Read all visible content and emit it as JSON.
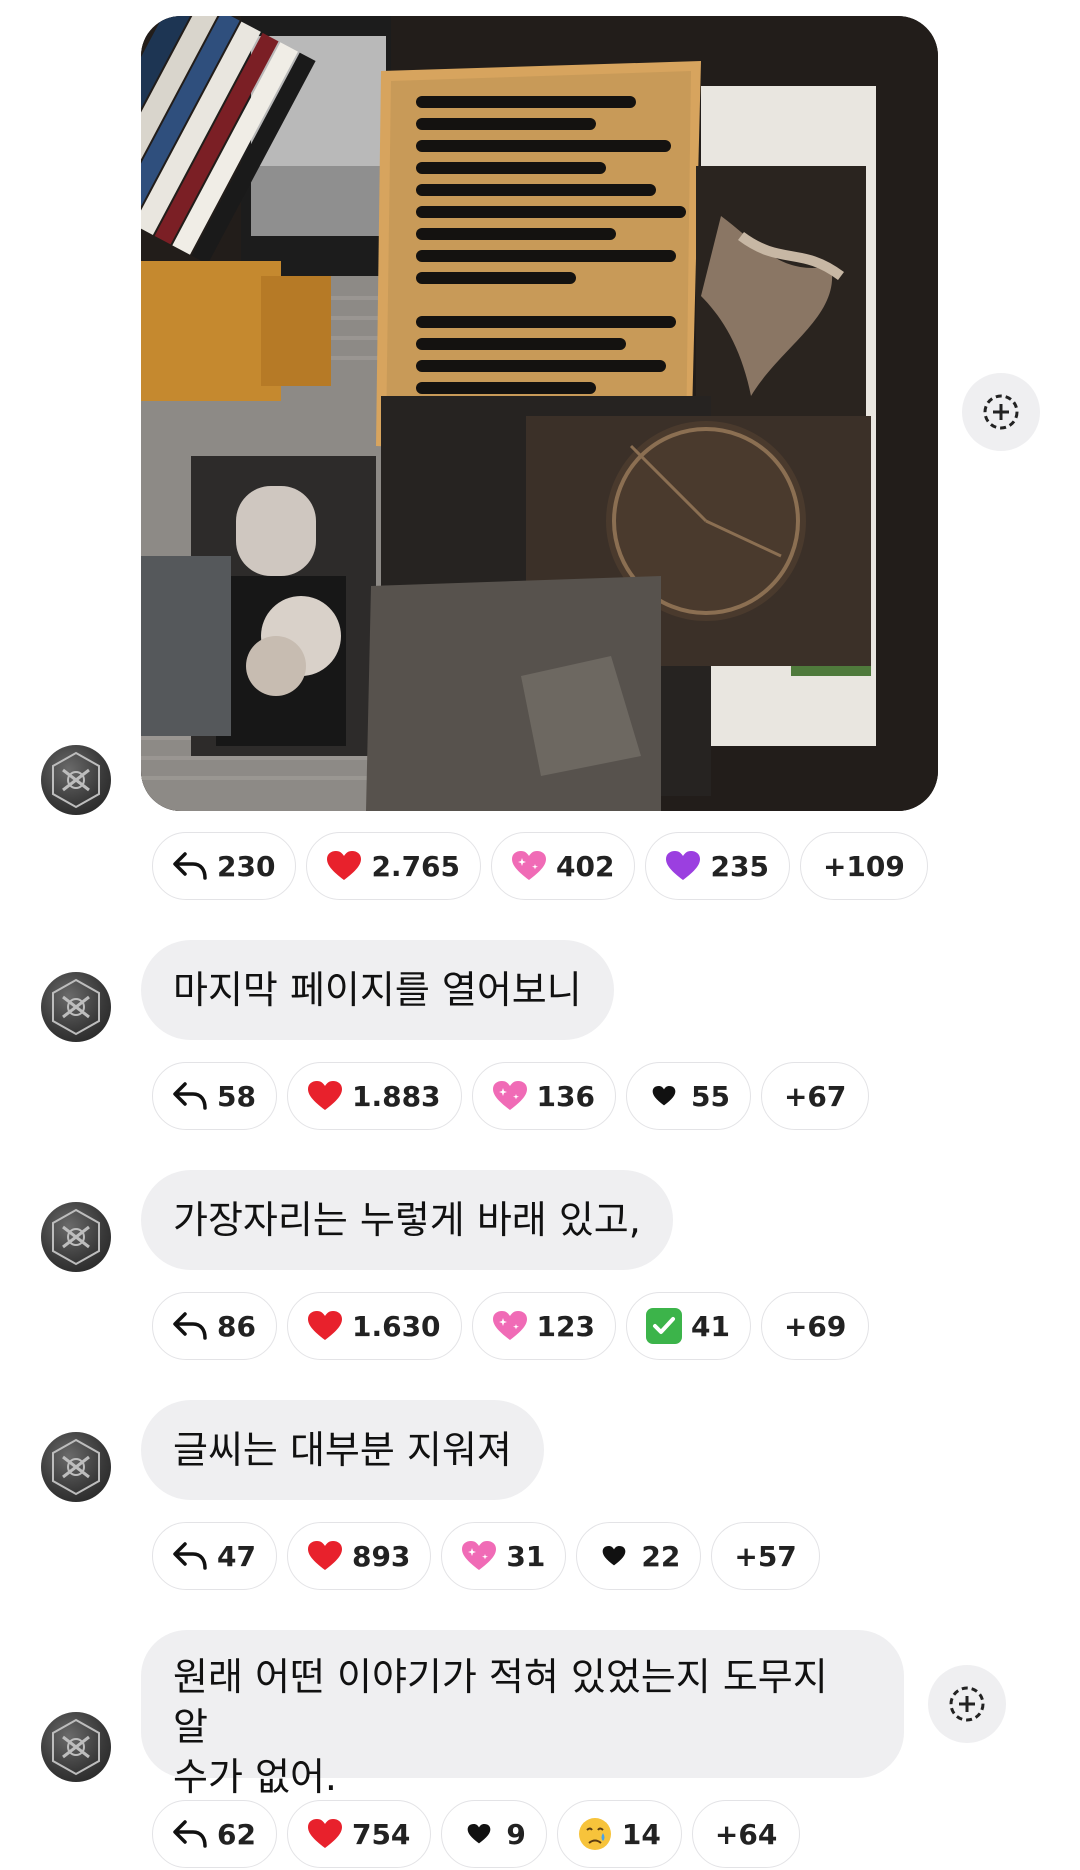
{
  "photo_message": {
    "reactions": [
      {
        "kind": "reply",
        "icon": "reply-icon",
        "count": "230"
      },
      {
        "kind": "emoji",
        "icon": "red-heart-icon",
        "count": "2.765"
      },
      {
        "kind": "emoji",
        "icon": "pink-sparkle-heart-icon",
        "count": "402"
      },
      {
        "kind": "emoji",
        "icon": "purple-heart-icon",
        "count": "235"
      },
      {
        "kind": "more",
        "count": "+109"
      }
    ]
  },
  "messages": [
    {
      "text": "마지막 페이지를 열어보니",
      "reactions": [
        {
          "kind": "reply",
          "icon": "reply-icon",
          "count": "58"
        },
        {
          "kind": "emoji",
          "icon": "red-heart-icon",
          "count": "1.883"
        },
        {
          "kind": "emoji",
          "icon": "pink-sparkle-heart-icon",
          "count": "136"
        },
        {
          "kind": "emoji",
          "icon": "black-heart-icon",
          "count": "55"
        },
        {
          "kind": "more",
          "count": "+67"
        }
      ]
    },
    {
      "text": "가장자리는 누렇게 바래 있고,",
      "reactions": [
        {
          "kind": "reply",
          "icon": "reply-icon",
          "count": "86"
        },
        {
          "kind": "emoji",
          "icon": "red-heart-icon",
          "count": "1.630"
        },
        {
          "kind": "emoji",
          "icon": "pink-sparkle-heart-icon",
          "count": "123"
        },
        {
          "kind": "emoji",
          "icon": "check-mark-icon",
          "count": "41"
        },
        {
          "kind": "more",
          "count": "+69"
        }
      ]
    },
    {
      "text": "글씨는 대부분 지워져",
      "reactions": [
        {
          "kind": "reply",
          "icon": "reply-icon",
          "count": "47"
        },
        {
          "kind": "emoji",
          "icon": "red-heart-icon",
          "count": "893"
        },
        {
          "kind": "emoji",
          "icon": "pink-sparkle-heart-icon",
          "count": "31"
        },
        {
          "kind": "emoji",
          "icon": "black-heart-icon",
          "count": "22"
        },
        {
          "kind": "more",
          "count": "+57"
        }
      ]
    },
    {
      "text": "원래 어떤 이야기가 적혀 있었는지 도무지 알\n수가 없어.",
      "reactions": [
        {
          "kind": "reply",
          "icon": "reply-icon",
          "count": "62"
        },
        {
          "kind": "emoji",
          "icon": "red-heart-icon",
          "count": "754"
        },
        {
          "kind": "emoji",
          "icon": "black-heart-icon",
          "count": "9"
        },
        {
          "kind": "emoji",
          "icon": "crying-face-icon",
          "count": "14"
        },
        {
          "kind": "more",
          "count": "+64"
        }
      ]
    }
  ],
  "colors": {
    "bubble_bg": "#efeff1",
    "red_heart": "#e8212c",
    "pink_heart": "#f06bb6",
    "purple_heart": "#9b3fe0",
    "check_green": "#3cb44a"
  }
}
